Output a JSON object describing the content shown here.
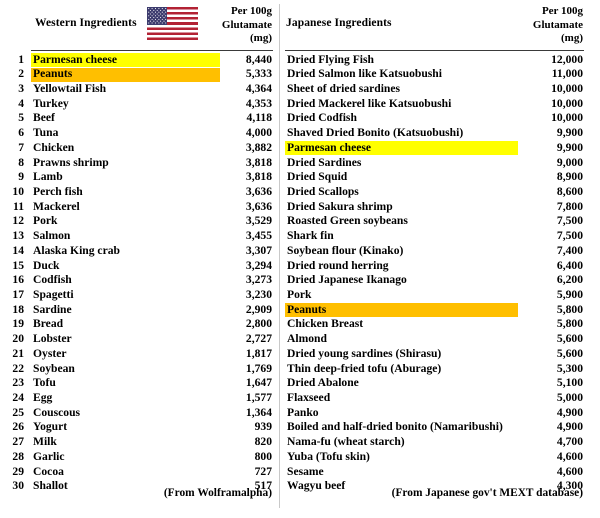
{
  "tables": [
    {
      "caption": "Western Ingredients",
      "flag": "us-flag-icon",
      "units_line1": "Per 100g",
      "units_line2": "Glutamate",
      "units_line3": "(mg)",
      "source": "(From Wolframalpha)",
      "numbered": true,
      "rows": [
        {
          "rank": "1",
          "name": "Parmesan cheese",
          "value": "8,440",
          "highlight": "yellow"
        },
        {
          "rank": "2",
          "name": "Peanuts",
          "value": "5,333",
          "highlight": "orange"
        },
        {
          "rank": "3",
          "name": "Yellowtail Fish",
          "value": "4,364",
          "highlight": "none"
        },
        {
          "rank": "4",
          "name": "Turkey",
          "value": "4,353",
          "highlight": "none"
        },
        {
          "rank": "5",
          "name": "Beef",
          "value": "4,118",
          "highlight": "none"
        },
        {
          "rank": "6",
          "name": "Tuna",
          "value": "4,000",
          "highlight": "none"
        },
        {
          "rank": "7",
          "name": "Chicken",
          "value": "3,882",
          "highlight": "none"
        },
        {
          "rank": "8",
          "name": "Prawns shrimp",
          "value": "3,818",
          "highlight": "none"
        },
        {
          "rank": "9",
          "name": "Lamb",
          "value": "3,818",
          "highlight": "none"
        },
        {
          "rank": "10",
          "name": "Perch fish",
          "value": "3,636",
          "highlight": "none"
        },
        {
          "rank": "11",
          "name": "Mackerel",
          "value": "3,636",
          "highlight": "none"
        },
        {
          "rank": "12",
          "name": "Pork",
          "value": "3,529",
          "highlight": "none"
        },
        {
          "rank": "13",
          "name": "Salmon",
          "value": "3,455",
          "highlight": "none"
        },
        {
          "rank": "14",
          "name": "Alaska King crab",
          "value": "3,307",
          "highlight": "none"
        },
        {
          "rank": "15",
          "name": "Duck",
          "value": "3,294",
          "highlight": "none"
        },
        {
          "rank": "16",
          "name": "Codfish",
          "value": "3,273",
          "highlight": "none"
        },
        {
          "rank": "17",
          "name": "Spagetti",
          "value": "3,230",
          "highlight": "none"
        },
        {
          "rank": "18",
          "name": "Sardine",
          "value": "2,909",
          "highlight": "none"
        },
        {
          "rank": "19",
          "name": "Bread",
          "value": "2,800",
          "highlight": "none"
        },
        {
          "rank": "20",
          "name": "Lobster",
          "value": "2,727",
          "highlight": "none"
        },
        {
          "rank": "21",
          "name": "Oyster",
          "value": "1,817",
          "highlight": "none"
        },
        {
          "rank": "22",
          "name": "Soybean",
          "value": "1,769",
          "highlight": "none"
        },
        {
          "rank": "23",
          "name": "Tofu",
          "value": "1,647",
          "highlight": "none"
        },
        {
          "rank": "24",
          "name": "Egg",
          "value": "1,577",
          "highlight": "none"
        },
        {
          "rank": "25",
          "name": "Couscous",
          "value": "1,364",
          "highlight": "none"
        },
        {
          "rank": "26",
          "name": "Yogurt",
          "value": "939",
          "highlight": "none"
        },
        {
          "rank": "27",
          "name": "Milk",
          "value": "820",
          "highlight": "none"
        },
        {
          "rank": "28",
          "name": "Garlic",
          "value": "800",
          "highlight": "none"
        },
        {
          "rank": "29",
          "name": "Cocoa",
          "value": "727",
          "highlight": "none"
        },
        {
          "rank": "30",
          "name": "Shallot",
          "value": "517",
          "highlight": "none"
        }
      ]
    },
    {
      "caption": "Japanese Ingredients",
      "flag": "japan-flag-icon",
      "units_line1": "Per 100g",
      "units_line2": "Glutamate",
      "units_line3": "(mg)",
      "source": "(From Japanese gov't MEXT database)",
      "numbered": false,
      "rows": [
        {
          "rank": "",
          "name": "Dried Flying Fish",
          "value": "12,000",
          "highlight": "none"
        },
        {
          "rank": "",
          "name": "Dried Salmon like Katsuobushi",
          "value": "11,000",
          "highlight": "none"
        },
        {
          "rank": "",
          "name": "Sheet of dried sardines",
          "value": "10,000",
          "highlight": "none"
        },
        {
          "rank": "",
          "name": "Dried Mackerel like Katsuobushi",
          "value": "10,000",
          "highlight": "none"
        },
        {
          "rank": "",
          "name": "Dried Codfish",
          "value": "10,000",
          "highlight": "none"
        },
        {
          "rank": "",
          "name": "Shaved Dried Bonito (Katsuobushi)",
          "value": "9,900",
          "highlight": "none"
        },
        {
          "rank": "",
          "name": "Parmesan cheese",
          "value": "9,900",
          "highlight": "yellow"
        },
        {
          "rank": "",
          "name": "Dried Sardines",
          "value": "9,000",
          "highlight": "none"
        },
        {
          "rank": "",
          "name": "Dried Squid",
          "value": "8,900",
          "highlight": "none"
        },
        {
          "rank": "",
          "name": "Dried Scallops",
          "value": "8,600",
          "highlight": "none"
        },
        {
          "rank": "",
          "name": "Dried Sakura shrimp",
          "value": "7,800",
          "highlight": "none"
        },
        {
          "rank": "",
          "name": "Roasted Green soybeans",
          "value": "7,500",
          "highlight": "none"
        },
        {
          "rank": "",
          "name": "Shark fin",
          "value": "7,500",
          "highlight": "none"
        },
        {
          "rank": "",
          "name": "Soybean flour (Kinako)",
          "value": "7,400",
          "highlight": "none"
        },
        {
          "rank": "",
          "name": "Dried round herring",
          "value": "6,400",
          "highlight": "none"
        },
        {
          "rank": "",
          "name": "Dried Japanese Ikanago",
          "value": "6,200",
          "highlight": "none"
        },
        {
          "rank": "",
          "name": "Pork",
          "value": "5,900",
          "highlight": "none"
        },
        {
          "rank": "",
          "name": "Peanuts",
          "value": "5,800",
          "highlight": "orange"
        },
        {
          "rank": "",
          "name": "Chicken Breast",
          "value": "5,800",
          "highlight": "none"
        },
        {
          "rank": "",
          "name": "Almond",
          "value": "5,600",
          "highlight": "none"
        },
        {
          "rank": "",
          "name": "Dried young sardines (Shirasu)",
          "value": "5,600",
          "highlight": "none"
        },
        {
          "rank": "",
          "name": "Thin deep-fried tofu (Aburage)",
          "value": "5,300",
          "highlight": "none"
        },
        {
          "rank": "",
          "name": "Dried Abalone",
          "value": "5,100",
          "highlight": "none"
        },
        {
          "rank": "",
          "name": "Flaxseed",
          "value": "5,000",
          "highlight": "none"
        },
        {
          "rank": "",
          "name": "Panko",
          "value": "4,900",
          "highlight": "none"
        },
        {
          "rank": "",
          "name": "Boiled and half-dried bonito (Namaribushi)",
          "value": "4,900",
          "highlight": "none"
        },
        {
          "rank": "",
          "name": "Nama-fu (wheat starch)",
          "value": "4,700",
          "highlight": "none"
        },
        {
          "rank": "",
          "name": "Yuba (Tofu skin)",
          "value": "4,600",
          "highlight": "none"
        },
        {
          "rank": "",
          "name": "Sesame",
          "value": "4,600",
          "highlight": "none"
        },
        {
          "rank": "",
          "name": "Wagyu beef",
          "value": "4,300",
          "highlight": "none"
        }
      ]
    }
  ],
  "colors": {
    "highlight_yellow": "#ffff00",
    "highlight_orange": "#ffbf00",
    "us_flag_red": "#b22234",
    "us_flag_blue": "#3c3b6e",
    "jp_flag_red": "#e01f26",
    "rule": "#3a3a3a"
  }
}
